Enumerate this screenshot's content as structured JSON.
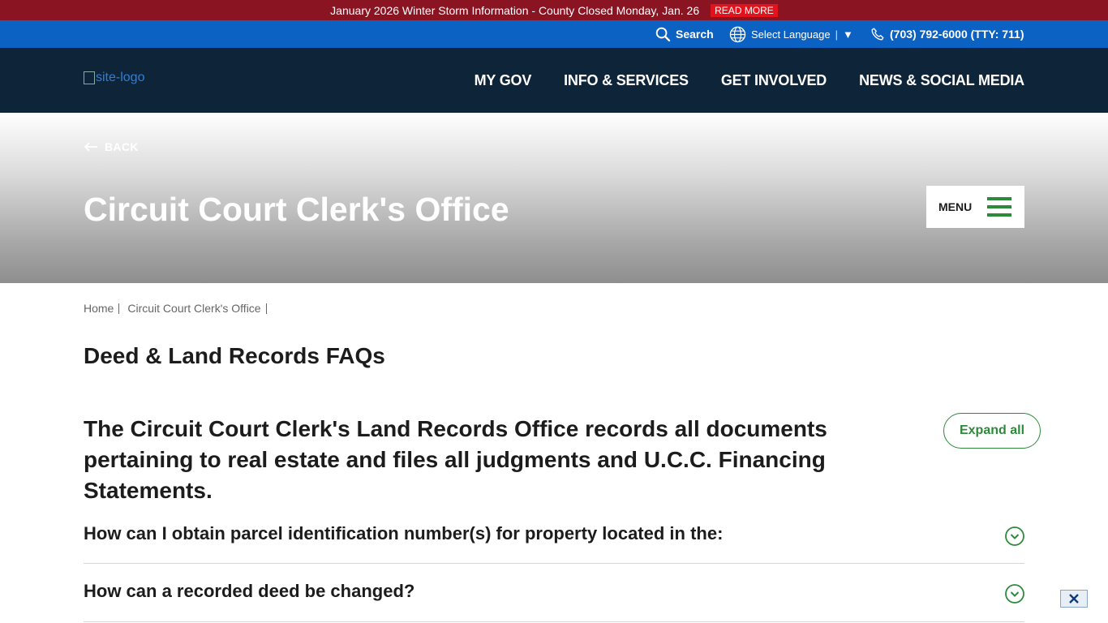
{
  "alert": {
    "message": "January 2026 Winter Storm Information - County Closed Monday, Jan. 26",
    "cta": "READ MORE"
  },
  "utility": {
    "search_label": "Search",
    "language_label": "Select Language",
    "language_arrow": "▼",
    "language_sep": "|",
    "phone": "(703) 792-6000 (TTY: 711)"
  },
  "nav": {
    "logo_alt": "site-logo",
    "links": [
      "MY GOV",
      "INFO & SERVICES",
      "GET INVOLVED",
      "NEWS & SOCIAL MEDIA"
    ]
  },
  "hero": {
    "back_label": "BACK",
    "title": "Circuit Court Clerk's Office",
    "menu_label": "MENU"
  },
  "breadcrumb": [
    "Home",
    "Circuit Court Clerk's Office"
  ],
  "page": {
    "heading": "Deed & Land Records FAQs",
    "intro": "The Circuit Court Clerk's Land Records Office records all documents pertaining to real estate and files all judgments and U.C.C. Financing Statements.",
    "expand_all": "Expand all"
  },
  "faqs": [
    "How can I obtain parcel identification number(s) for property located in the:",
    "How can a recorded deed be changed?"
  ],
  "colors": {
    "alert_bg": "#8a1422",
    "utility_bg": "#0b62c2",
    "nav_bg": "#0e2439",
    "accent_green": "#2d8a3a"
  },
  "icons": {
    "search": "search-icon",
    "globe": "globe-icon",
    "phone": "phone-icon",
    "back": "arrow-left-icon",
    "menu": "hamburger-icon",
    "chevron": "chevron-down-circle-icon",
    "close": "close-icon"
  }
}
